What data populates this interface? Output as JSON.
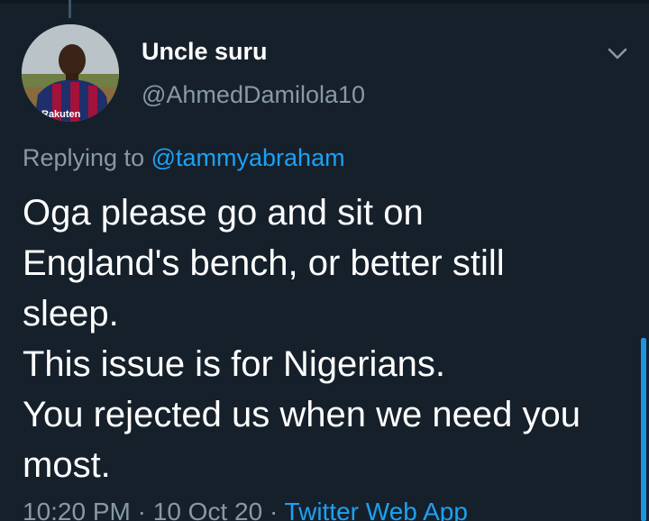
{
  "tweet": {
    "display_name": "Uncle suru",
    "handle": "@AhmedDamilola10",
    "replying_to_label": "Replying to",
    "replying_to_handle": "@tammyabraham",
    "text_lines": [
      "Oga please go and sit on",
      "England's bench, or better still",
      "sleep.",
      "This issue is for Nigerians.",
      "You rejected us when we need you",
      "most."
    ],
    "time": "10:20 PM",
    "separator": "·",
    "date": "10 Oct 20",
    "source": "Twitter Web App",
    "avatar_jersey_text": "Rakuten"
  },
  "icons": {
    "menu": "chevron-down-icon"
  },
  "colors": {
    "background": "#15202b",
    "primary_text": "#ffffff",
    "secondary_text": "#8899a6",
    "accent": "#1da1f2"
  }
}
